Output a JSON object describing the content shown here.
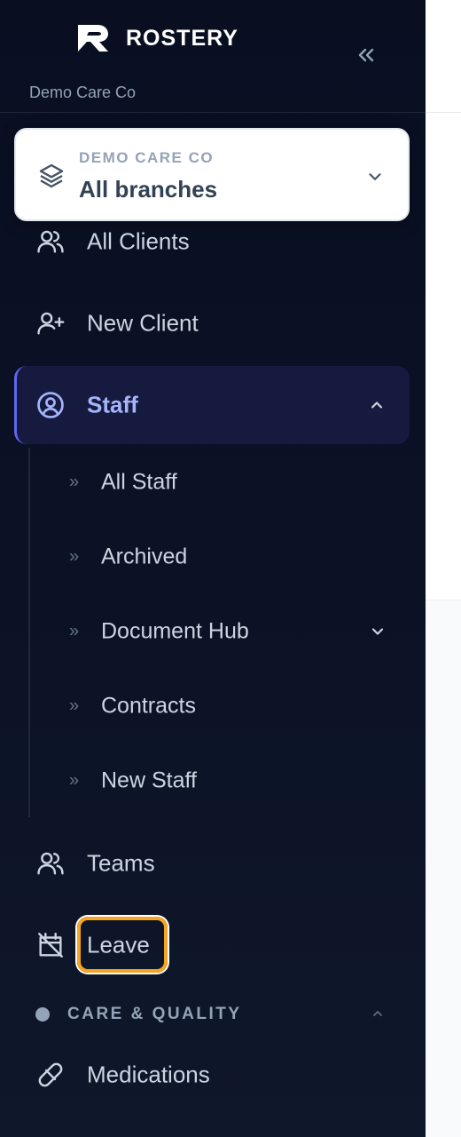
{
  "brand": {
    "name": "ROSTERY",
    "org_label": "Demo Care Co"
  },
  "branch_selector": {
    "org": "DEMO CARE CO",
    "branch": "All branches"
  },
  "nav": {
    "all_clients": "All Clients",
    "new_client": "New Client",
    "staff": "Staff",
    "staff_sub": [
      "All Staff",
      "Archived",
      "Document Hub",
      "Contracts",
      "New Staff"
    ],
    "teams": "Teams",
    "leave": "Leave",
    "section_care": "CARE & QUALITY",
    "medications": "Medications"
  },
  "colors": {
    "sidebar_bg": "#0b1226",
    "active_accent": "#6366f1",
    "active_text": "#a5b4fc",
    "focus_ring": "#f5a524",
    "text": "#cbd5e1",
    "muted": "#94a3b8"
  },
  "icons": {
    "logo": "r-logo-icon",
    "collapse": "double-chevron-left-icon",
    "branch": "layers-icon",
    "clients": "users-icon",
    "new_client": "user-plus-icon",
    "staff": "user-circle-icon",
    "teams": "users-icon",
    "leave": "calendar-off-icon",
    "medications": "pill-icon"
  }
}
